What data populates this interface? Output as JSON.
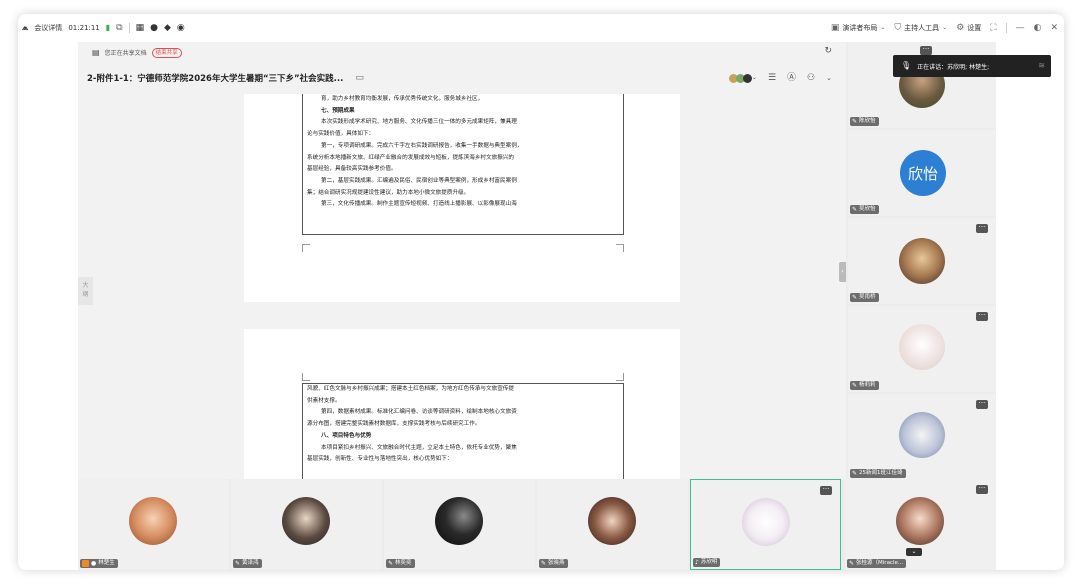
{
  "titlebar": {
    "meeting_details": "会议详情",
    "duration": "01:21:11",
    "layout": "演讲者布局",
    "host_tools": "主持人工具",
    "settings": "设置"
  },
  "doc": {
    "sharing_label": "您正在共享文档",
    "stop_share": "结束共享",
    "title": "2-附件1-1：宁德师范学院2026年大学生暑期“三下乡”社会实践...",
    "outline_tab": "大纲",
    "page1_lines": [
      "育，助力乡村教育均衡发展，传承优秀传统文化，服务城乡社区，",
      "七、预期成果",
      "本次实践形成学术研究、地方服务、文化传播三位一体的多元成果矩阵，兼具理",
      "论与实践价值，具体如下：",
      "第一，专项调研成果。完成六千字左右实践调研报告，收集一手数据与典型案例，",
      "系统分析本地播新文旅、红绿产业融合的发展成效与短板，提炼滨海乡村文旅振兴的",
      "基层经验，具备较高实践参考价值。",
      "第二，基层实践成果。汇编遍及民俗、民宿创业等典型案例，形成乡村富民案例",
      "集；结合调研实况规提建设性建议，助力本地小微文旅提质升级。",
      "第三，文化传播成果。制作主题宣传短视频、打造线上播影展、以影像展现山海"
    ],
    "page2_lines": [
      "风貌、红色文脉与乡村振兴成果；搭建本土红色档案，为地方红色传承与文旅宣传提",
      "供素材支撑。",
      "第四，数据素材成果。标准化汇编问卷、访谈等调研资料，绘制本地核心文旅资",
      "源分布图，搭建完整实践素材数据库，支撑实践考核与后续研究工作。",
      "八、项目特色与优势",
      "本项目紧扣乡村振兴、文旅融合时代主题，立足本土特色，依托专业优势，聚焦",
      "基层实践，创新性、专业性与落地性突出，核心优势如下："
    ]
  },
  "speaker_popup": {
    "label": "正在讲话：苏欣明; 林楚生;"
  },
  "right_tiles": [
    {
      "name": "陈欣怡"
    },
    {
      "name": "吴欣怡",
      "avatar_text": "欣怡"
    },
    {
      "name": "吴雨桥"
    },
    {
      "name": "杨莉莉"
    },
    {
      "name": "25新闻1班江佳琦"
    },
    {
      "name": "张桂源（Miracle..."
    }
  ],
  "bottom_tiles": [
    {
      "name": "林楚生"
    },
    {
      "name": "黄泽鸿"
    },
    {
      "name": "林奕奕"
    },
    {
      "name": "张晓燕"
    },
    {
      "name": "苏欣明"
    }
  ],
  "colors": {
    "active_border": "#3ebf8f",
    "stop_share": "#e05050",
    "signal": "#2fb34b",
    "avatar_blue": "#2d7fd3"
  }
}
